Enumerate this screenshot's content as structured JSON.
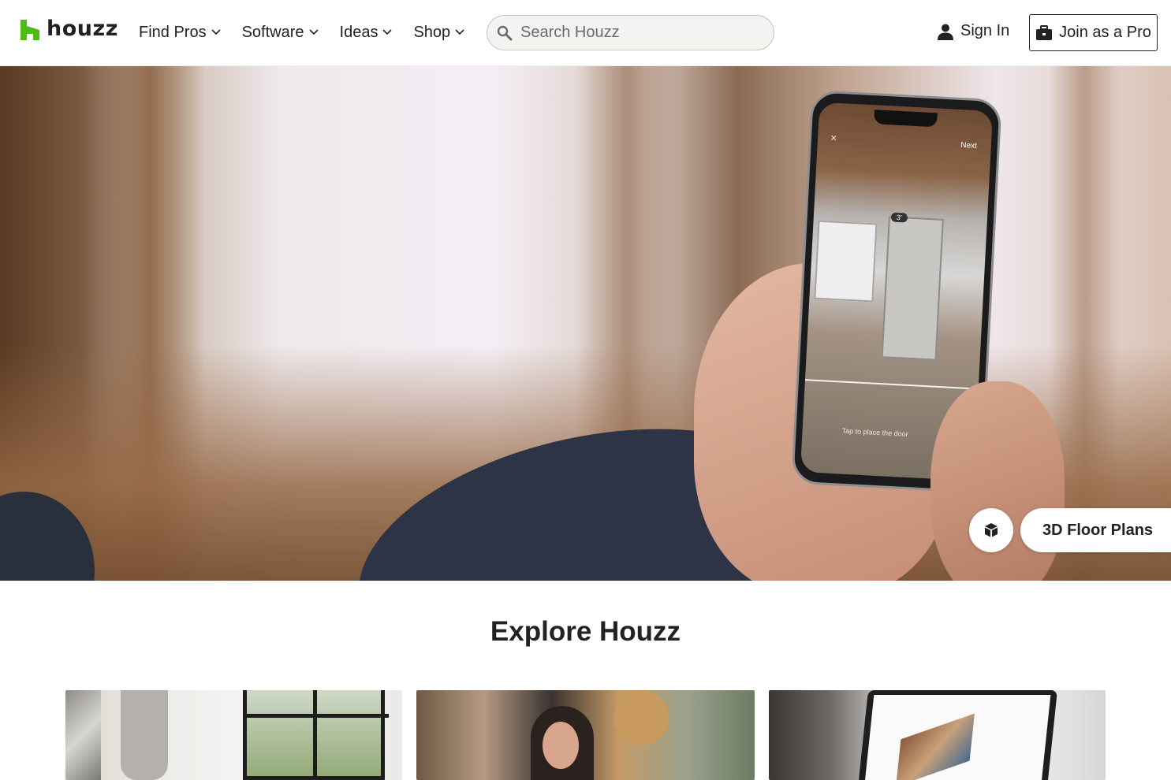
{
  "header": {
    "logo_text": "houzz",
    "nav": [
      {
        "label": "Find Pros"
      },
      {
        "label": "Software"
      },
      {
        "label": "Ideas"
      },
      {
        "label": "Shop"
      }
    ],
    "search": {
      "placeholder": "Search Houzz",
      "value": ""
    },
    "sign_in_label": "Sign In",
    "join_label": "Join as a Pro"
  },
  "hero": {
    "phone": {
      "close": "×",
      "next": "Next",
      "dimension": "3'",
      "hint": "Tap to place the door"
    },
    "badge_label": "3D Floor Plans"
  },
  "explore": {
    "title": "Explore Houzz"
  },
  "colors": {
    "brand_green": "#4DBC15",
    "text": "#222222",
    "search_bg": "#F4F3F1"
  }
}
